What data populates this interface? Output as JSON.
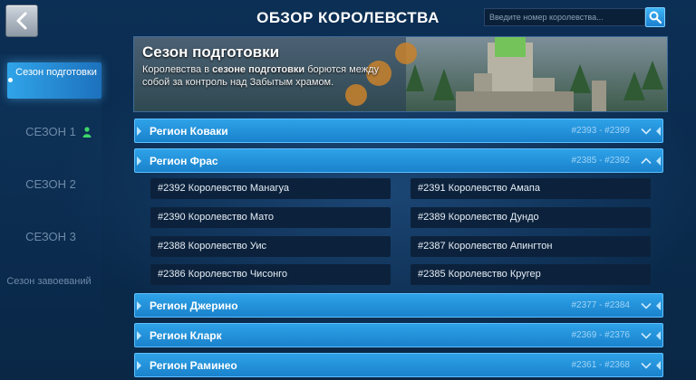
{
  "header": {
    "title": "ОБЗОР КОРОЛЕВСТВА",
    "search_placeholder": "Введите номер королевства..."
  },
  "sidebar": {
    "items": [
      {
        "label": "Сезон подготовки",
        "active": true
      },
      {
        "label": "СЕЗОН 1"
      },
      {
        "label": "СЕЗОН 2"
      },
      {
        "label": "СЕЗОН 3"
      },
      {
        "label": "Сезон завоеваний"
      }
    ]
  },
  "banner": {
    "title": "Сезон подготовки",
    "text_before": "Королевства в ",
    "text_bold": "сезоне подготовки",
    "text_after": " борются между собой за контроль над Забытым храмом."
  },
  "regions": [
    {
      "name": "Регион Коваки",
      "range": "#2393 - #2399",
      "expanded": false
    },
    {
      "name": "Регион Фрас",
      "range": "#2385 - #2392",
      "expanded": true,
      "kingdoms": [
        "#2392 Королевство Манагуа",
        "#2391 Королевство Амапа",
        "#2390 Королевство Мато",
        "#2389 Королевство Дундо",
        "#2388 Королевство Уис",
        "#2387 Королевство Апингтон",
        "#2386 Королевство Чисонго",
        "#2385 Королевство Кругер"
      ]
    },
    {
      "name": "Регион Джерино",
      "range": "#2377 - #2384",
      "expanded": false
    },
    {
      "name": "Регион Кларк",
      "range": "#2369 - #2376",
      "expanded": false
    },
    {
      "name": "Регион Раминео",
      "range": "#2361 - #2368",
      "expanded": false
    }
  ],
  "colors": {
    "accent": "#2ea2e8",
    "background": "#0b2d4f",
    "range_text": "#9fd3f6",
    "season_icon": "#3fd66b"
  },
  "icons": {
    "back": "chevron-left-icon",
    "search": "search-icon",
    "season1": "person-icon",
    "region_collapsed": "chevron-down-icon",
    "region_expanded": "chevron-up-icon"
  }
}
